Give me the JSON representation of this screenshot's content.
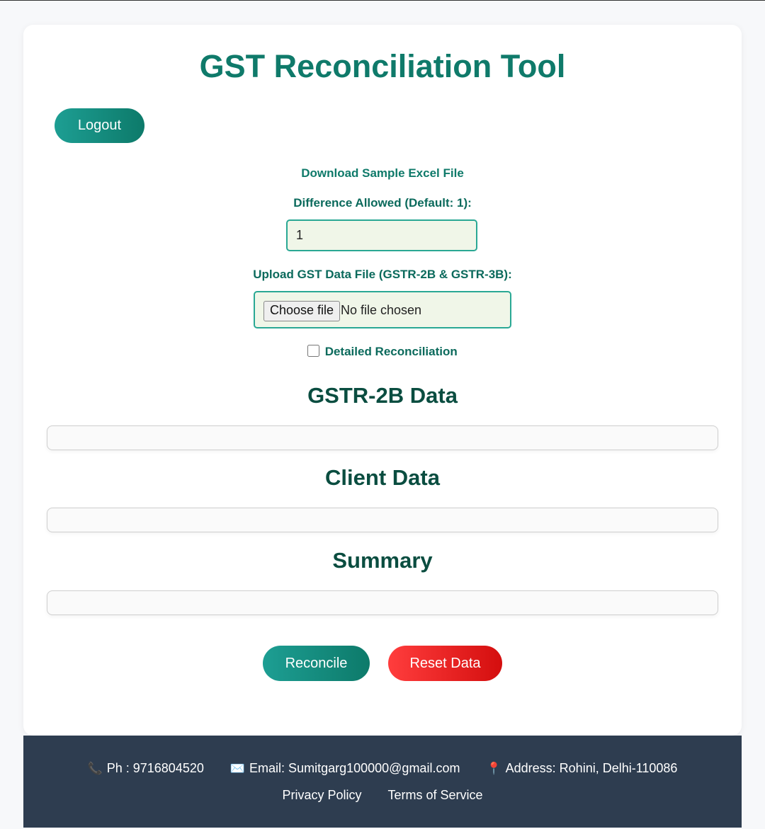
{
  "page": {
    "title": "GST Reconciliation Tool"
  },
  "header": {
    "logout_label": "Logout"
  },
  "form": {
    "download_link": "Download Sample Excel File",
    "difference_label": "Difference Allowed (Default: 1):",
    "difference_value": "1",
    "upload_label": "Upload GST Data File (GSTR-2B & GSTR-3B):",
    "choose_file_label": "Choose file",
    "file_status": "No file chosen",
    "detailed_label": "Detailed Reconciliation",
    "detailed_checked": false
  },
  "sections": {
    "gstr2b_title": "GSTR-2B Data",
    "client_title": "Client Data",
    "summary_title": "Summary"
  },
  "actions": {
    "reconcile_label": "Reconcile",
    "reset_label": "Reset Data"
  },
  "footer": {
    "phone_icon": "📞",
    "phone": "Ph : 9716804520",
    "email_icon": "✉️",
    "email": "Email: Sumitgarg100000@gmail.com",
    "address_icon": "📍",
    "address": "Address: Rohini, Delhi-110086",
    "privacy": "Privacy Policy",
    "terms": "Terms of Service"
  },
  "colors": {
    "brand": "#0f7a6a",
    "danger": "#e31b1b",
    "footer_bg": "#2e3d50"
  }
}
